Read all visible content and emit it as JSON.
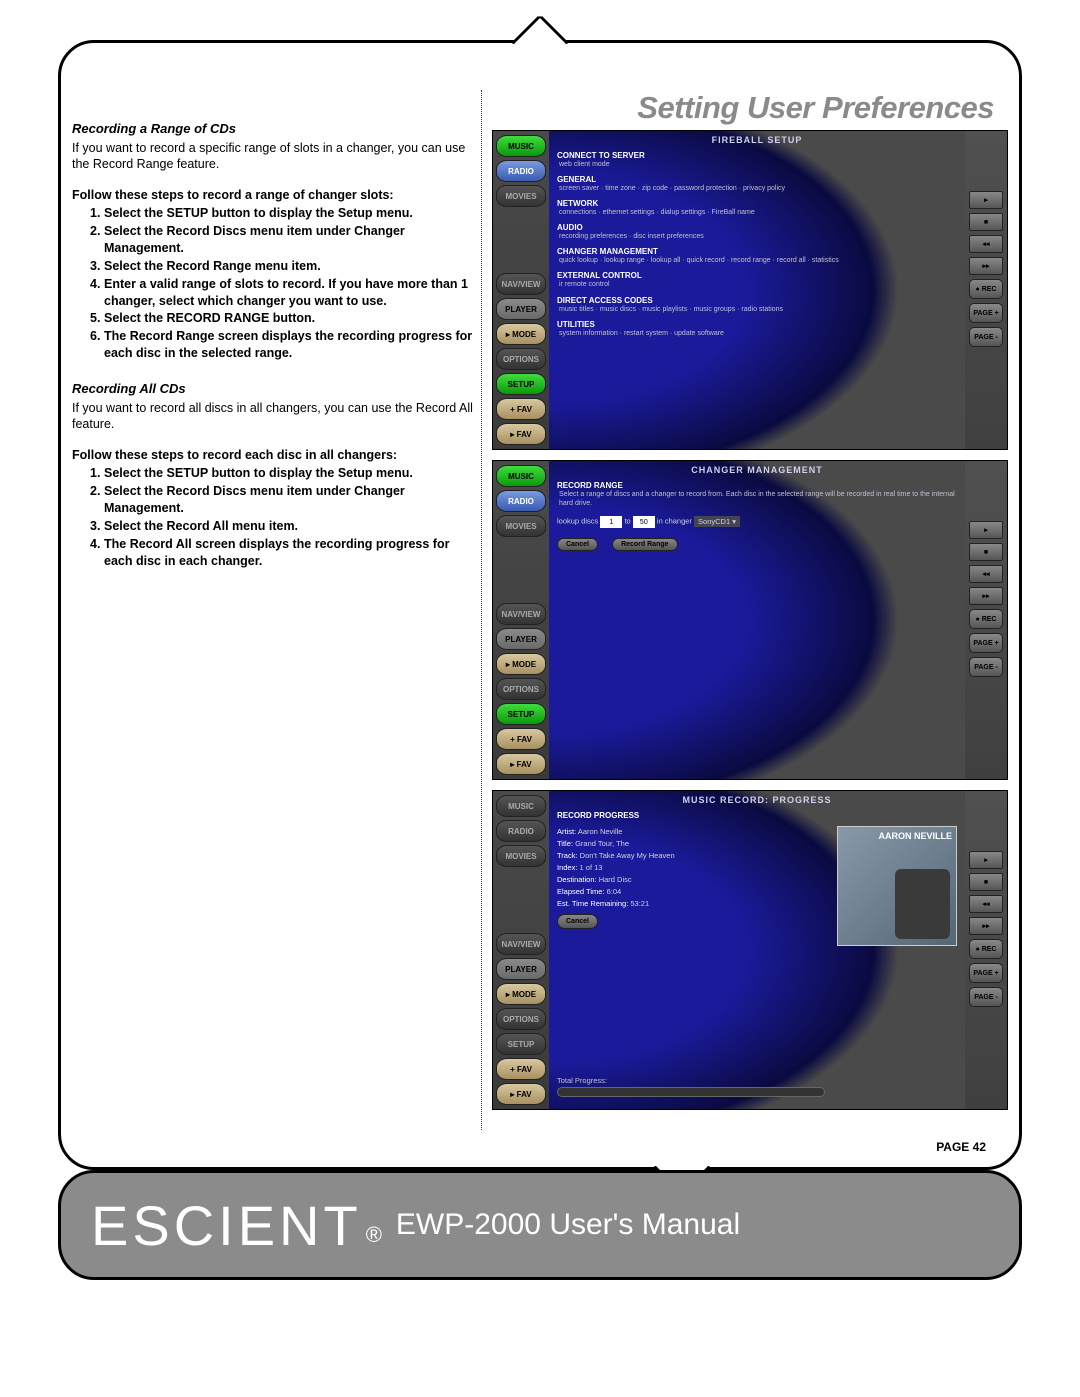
{
  "chapter_title": "Setting User Preferences",
  "section1": {
    "heading": "Recording a Range of CDs",
    "intro": "If you want to record a specific range of slots in a changer, you can use the Record Range feature.",
    "steps_intro": "Follow these steps to record a range of changer slots:",
    "steps": [
      "Select the SETUP button to display the Setup menu.",
      "Select the Record Discs menu item under Changer Management.",
      "Select the Record Range menu item.",
      "Enter a valid range of slots to record. If you have more than 1 changer, select which changer you want to use.",
      "Select the RECORD RANGE button.",
      "The Record Range screen displays the recording progress for each disc in the selected range."
    ]
  },
  "section2": {
    "heading": "Recording All CDs",
    "intro": "If you want to record all discs in all changers, you can use the Record All feature.",
    "steps_intro": "Follow these steps to record each disc in all changers:",
    "steps": [
      "Select the SETUP button to display the Setup menu.",
      "Select the Record Discs menu item under Changer Management.",
      "Select the Record All menu item.",
      "The Record All screen displays the recording progress for each disc in each changer."
    ]
  },
  "sidebar_buttons": [
    "MUSIC",
    "RADIO",
    "MOVIES",
    "NAV/VIEW",
    "PLAYER",
    "▸ MODE",
    "OPTIONS",
    "SETUP",
    "+ FAV",
    "▸ FAV"
  ],
  "right_buttons": [
    "▸",
    "■",
    "◂◂",
    "▸▸",
    "● REC",
    "PAGE +",
    "PAGE -"
  ],
  "screenshot1": {
    "title": "FIREBALL SETUP",
    "sections": [
      {
        "h": "CONNECT TO SERVER",
        "sub": "web client mode"
      },
      {
        "h": "GENERAL",
        "sub": "screen saver · time zone · zip code · password protection · privacy policy"
      },
      {
        "h": "NETWORK",
        "sub": "connections · ethernet settings · dialup settings · FireBall name"
      },
      {
        "h": "AUDIO",
        "sub": "recording preferences · disc insert preferences"
      },
      {
        "h": "CHANGER MANAGEMENT",
        "sub": "quick lookup · lookup range · lookup all · quick record · record range · record all · statistics"
      },
      {
        "h": "EXTERNAL CONTROL",
        "sub": "ir remote control"
      },
      {
        "h": "DIRECT ACCESS CODES",
        "sub": "music titles · music discs · music playlists · music groups · radio stations"
      },
      {
        "h": "UTILITIES",
        "sub": "system information · restart system · update software"
      }
    ]
  },
  "screenshot2": {
    "title": "CHANGER MANAGEMENT",
    "section_h": "RECORD RANGE",
    "section_sub": "Select a range of discs and a changer to record from. Each disc in the selected range will be recorded in real time to the internal hard drive.",
    "form_prefix": "lookup discs",
    "from": "1",
    "to": "50",
    "mid": "in changer",
    "changer": "SonyCD1 ▾",
    "btn_cancel": "Cancel",
    "btn_range": "Record Range"
  },
  "screenshot3": {
    "title": "MUSIC RECORD: PROGRESS",
    "section_h": "RECORD PROGRESS",
    "artist_l": "Artist:",
    "artist_v": "Aaron Neville",
    "title_l": "Title:",
    "title_v": "Grand Tour, The",
    "track_l": "Track:",
    "track_v": "Don't Take Away My Heaven",
    "index_l": "Index:",
    "index_v": "1 of 13",
    "dest_l": "Destination:",
    "dest_v": "Hard Disc",
    "elapsed_l": "Elapsed Time:",
    "elapsed_v": "6:04",
    "remain_l": "Est. Time Remaining:",
    "remain_v": "53:21",
    "cover_text": "AARON NEVILLE",
    "cancel": "Cancel",
    "progress_l": "Total Progress:"
  },
  "page_label": "PAGE 42",
  "footer": {
    "brand": "ESCIENT",
    "reg": "®",
    "manual": "EWP-2000 User's Manual"
  }
}
